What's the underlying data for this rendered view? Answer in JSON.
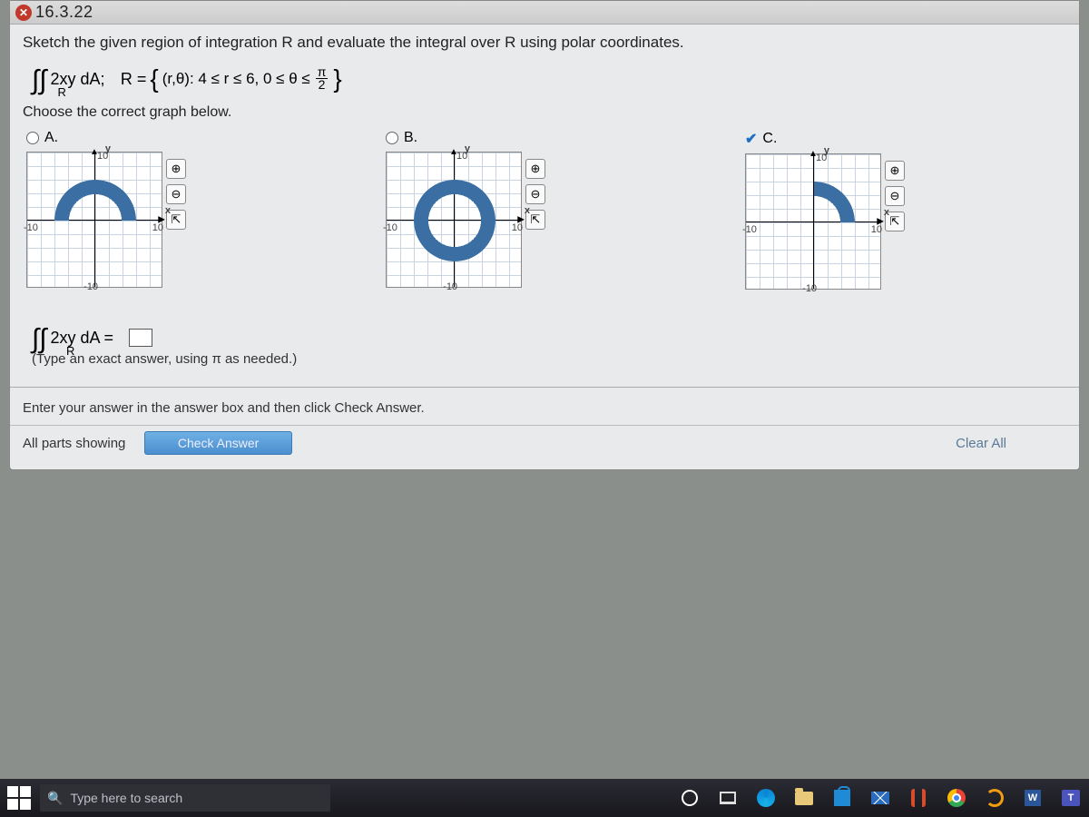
{
  "window": {
    "title": "16.3.22",
    "problem": "Sketch the given region of integration R and evaluate the integral over R using polar coordinates.",
    "integrand": "2xy dA;",
    "region_prefix": "R =",
    "region_body": "(r,θ): 4 ≤ r ≤ 6, 0 ≤ θ ≤",
    "frac_top": "π",
    "frac_bot": "2",
    "choose": "Choose the correct graph below.",
    "options": [
      {
        "label": "A.",
        "selected": false,
        "shape": "half-top"
      },
      {
        "label": "B.",
        "selected": false,
        "shape": "full-annulus"
      },
      {
        "label": "C.",
        "selected": true,
        "shape": "quarter"
      }
    ],
    "axis": {
      "y": "y",
      "x": "x",
      "p10": "10",
      "n10": "-10"
    },
    "tools": {
      "zoom_in": "⊕",
      "zoom_out": "⊖",
      "popout": "⇱"
    },
    "answer_label_left": "2xy dA =",
    "hint": "(Type an exact answer, using π as needed.)",
    "enter": "Enter your answer in the answer box and then click Check Answer.",
    "all_parts": "All parts showing",
    "check_btn": "Check Answer",
    "clear_all": "Clear All"
  },
  "taskbar": {
    "search_placeholder": "Type here to search"
  },
  "chart_data": [
    {
      "type": "area",
      "title": "Option A — upper half annulus",
      "xlabel": "x",
      "ylabel": "y",
      "xlim": [
        -10,
        10
      ],
      "ylim": [
        -10,
        10
      ],
      "region": {
        "r_min": 4,
        "r_max": 6,
        "theta_min_deg": 0,
        "theta_max_deg": 180
      }
    },
    {
      "type": "area",
      "title": "Option B — full annulus",
      "xlabel": "x",
      "ylabel": "y",
      "xlim": [
        -10,
        10
      ],
      "ylim": [
        -10,
        10
      ],
      "region": {
        "r_min": 4,
        "r_max": 6,
        "theta_min_deg": 0,
        "theta_max_deg": 360
      }
    },
    {
      "type": "area",
      "title": "Option C — first-quadrant quarter annulus",
      "xlabel": "x",
      "ylabel": "y",
      "xlim": [
        -10,
        10
      ],
      "ylim": [
        -10,
        10
      ],
      "region": {
        "r_min": 4,
        "r_max": 6,
        "theta_min_deg": 0,
        "theta_max_deg": 90
      }
    }
  ]
}
